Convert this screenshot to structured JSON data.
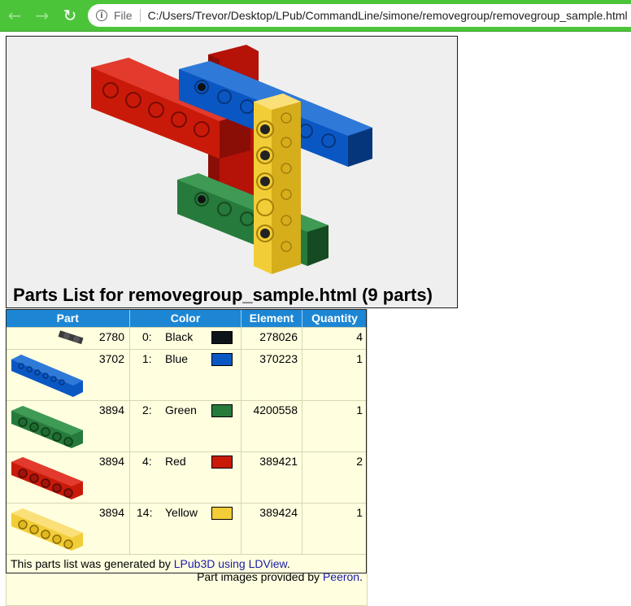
{
  "browser": {
    "file_label": "File",
    "url": "C:/Users/Trevor/Desktop/LPub/CommandLine/simone/removegroup/removegroup_sample.html",
    "back_icon": "arrow-left-icon",
    "forward_icon": "arrow-right-icon",
    "reload_icon": "reload-icon",
    "info_icon": "info-icon"
  },
  "page": {
    "title": "Parts List for removegroup_sample.html (9 parts)",
    "headers": [
      "Part",
      "Color",
      "Element",
      "Quantity"
    ],
    "rows": [
      {
        "part": "2780",
        "code": "0:",
        "color": "Black",
        "swatch": "#0d1419",
        "element": "278026",
        "quantity": "4"
      },
      {
        "part": "3702",
        "code": "1:",
        "color": "Blue",
        "swatch": "#0a57c4",
        "element": "370223",
        "quantity": "1"
      },
      {
        "part": "3894",
        "code": "2:",
        "color": "Green",
        "swatch": "#267a3b",
        "element": "4200558",
        "quantity": "1"
      },
      {
        "part": "3894",
        "code": "4:",
        "color": "Red",
        "swatch": "#c91a09",
        "element": "389421",
        "quantity": "2"
      },
      {
        "part": "3894",
        "code": "14:",
        "color": "Yellow",
        "swatch": "#f2cd37",
        "element": "389424",
        "quantity": "1"
      }
    ],
    "footer": {
      "left_prefix": "This parts list was generated by ",
      "left_link": "LPub3D using LDView",
      "left_suffix": ".",
      "right_prefix": "Part images provided by ",
      "right_link": "Peeron",
      "right_suffix": "."
    }
  }
}
